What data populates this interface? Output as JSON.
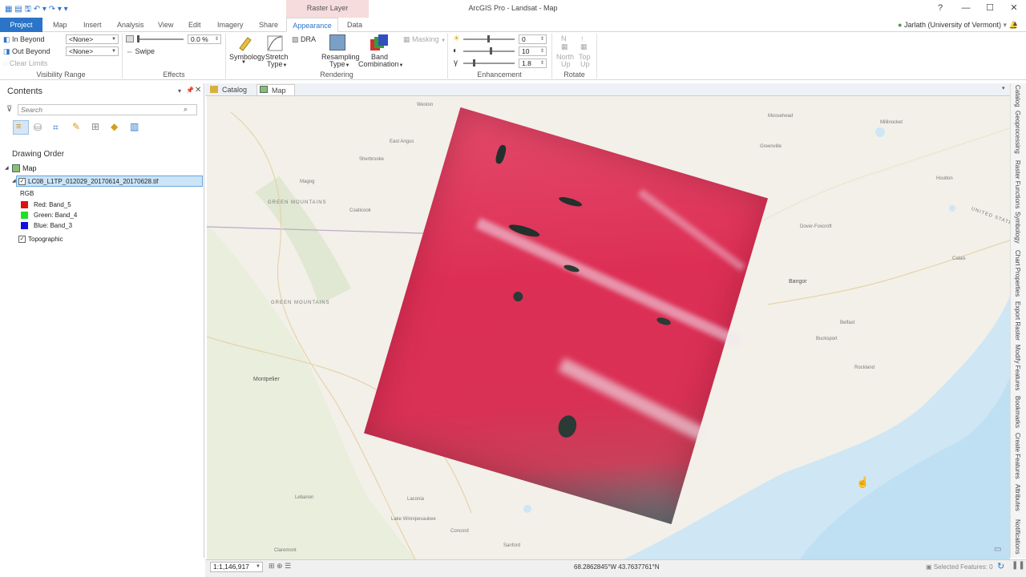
{
  "window": {
    "title": "ArcGIS Pro - Landsat - Map",
    "context_tab": "Raster Layer",
    "help": "?",
    "minimize": "—",
    "maximize": "☐",
    "close": "✕"
  },
  "ribbon_tabs": [
    "Project",
    "Map",
    "Insert",
    "Analysis",
    "View",
    "Edit",
    "Imagery",
    "Share",
    "Appearance",
    "Data"
  ],
  "user": "Jarlath (University of Vermont)",
  "ribbon": {
    "visibility": {
      "in_beyond": "In Beyond",
      "out_beyond": "Out Beyond",
      "clear_limits": "Clear Limits",
      "in_value": "<None>",
      "out_value": "<None>",
      "group": "Visibility Range"
    },
    "effects": {
      "transparency": "0.0 %",
      "swipe": "Swipe",
      "group": "Effects"
    },
    "rendering": {
      "symbology": "Symbology",
      "stretch": "Stretch",
      "stretch2": "Type",
      "dra": "DRA",
      "resampling": "Resampling",
      "resampling2": "Type",
      "band": "Band",
      "band2": "Combination",
      "masking": "Masking",
      "group": "Rendering"
    },
    "enhancement": {
      "brightness": "0",
      "contrast": "10",
      "gamma": "1.8",
      "group": "Enhancement"
    },
    "rotate": {
      "north": "North",
      "north2": "Up",
      "top": "Top",
      "top2": "Up",
      "group": "Rotate"
    }
  },
  "contents": {
    "title": "Contents",
    "search_placeholder": "Search",
    "drawing_order": "Drawing Order",
    "map": "Map",
    "layer": "LC08_L1TP_012029_20170614_20170628.tif",
    "rgb": "RGB",
    "red": "Red:   Band_5",
    "green": "Green: Band_4",
    "blue": "Blue:  Band_3",
    "topographic": "Topographic"
  },
  "view_tabs": [
    "Catalog",
    "Map"
  ],
  "map_labels": [
    {
      "text": "Weston"
    },
    {
      "text": "East Angus"
    },
    {
      "text": "Sherbrooke"
    },
    {
      "text": "Magog"
    },
    {
      "text": "Coaticook"
    },
    {
      "text": "GREEN MOUNTAINS"
    },
    {
      "text": "GREEN MOUNTAINS"
    },
    {
      "text": "Montpelier"
    },
    {
      "text": "Lebanon"
    },
    {
      "text": "Claremont"
    },
    {
      "text": "Bangor"
    },
    {
      "text": "Millinocket"
    },
    {
      "text": "Bucksport"
    },
    {
      "text": "UNITED STATES"
    },
    {
      "text": "Lake Winnipesaukee"
    },
    {
      "text": "Sanford"
    },
    {
      "text": "Concord"
    },
    {
      "text": "Laconia"
    },
    {
      "text": "Moosehead"
    },
    {
      "text": "Greenville"
    },
    {
      "text": "Dover-Foxcroft"
    },
    {
      "text": "Houlton"
    },
    {
      "text": "Calais"
    },
    {
      "text": "Rockland"
    },
    {
      "text": "Belfast"
    }
  ],
  "right_dock": [
    "Catalog",
    "Geoprocessing",
    "Raster Functions",
    "Symbology",
    "Chart Properties",
    "Export Raster",
    "Modify Features",
    "Bookmarks",
    "Create Features",
    "Attributes",
    "Notifications"
  ],
  "status": {
    "scale": "1:1,146,917",
    "coords": "68.2862845°W 43.7637761°N",
    "selected": "Selected Features: 0"
  },
  "colors": {
    "accent": "#2b74c7",
    "raster": "#e0335a",
    "context_tab": "#f6dcdc"
  }
}
